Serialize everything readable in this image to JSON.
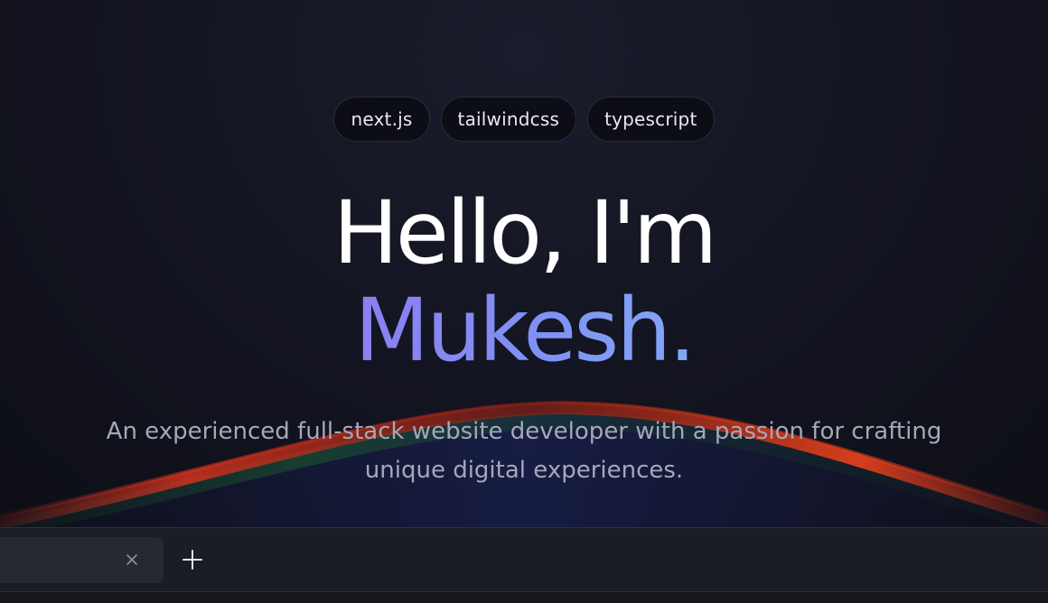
{
  "hero": {
    "tags": [
      "next.js",
      "tailwindcss",
      "typescript"
    ],
    "greeting": "Hello, I'm",
    "name": "Mukesh.",
    "description_line1": "An experienced full-stack website developer with a passion for crafting",
    "description_line2": "unique digital experiences."
  },
  "tabbar": {
    "close_icon": "close-icon",
    "new_tab_icon": "plus-icon"
  },
  "colors": {
    "background": "#0e0f17",
    "accent_name": "#8090f4",
    "tab_bar": "#1b1d24"
  }
}
